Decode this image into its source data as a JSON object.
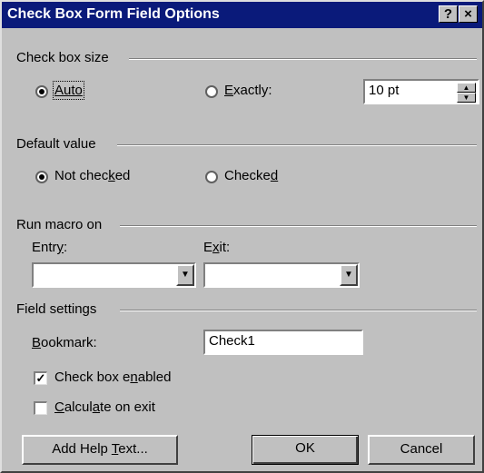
{
  "window": {
    "title": "Check Box Form Field Options",
    "help_btn": "?",
    "close_btn": "×"
  },
  "size_group": {
    "label": "Check box size",
    "auto": "Auto",
    "exactly_prefix": "",
    "exactly_u": "E",
    "exactly_rest": "xactly:",
    "value": "10 pt"
  },
  "default_group": {
    "label": "Default value",
    "not_checked_a": "Not chec",
    "not_checked_u": "k",
    "not_checked_b": "ed",
    "checked_a": "Checke",
    "checked_u": "d"
  },
  "macro_group": {
    "label": "Run macro on",
    "entry_a": "Entr",
    "entry_u": "y",
    "entry_b": ":",
    "exit_a": "E",
    "exit_u": "x",
    "exit_b": "it:",
    "entry_value": "",
    "exit_value": ""
  },
  "field_group": {
    "label": "Field settings",
    "bookmark_u": "B",
    "bookmark_rest": "ookmark:",
    "bookmark_value": "Check1",
    "enabled_a": "Check box e",
    "enabled_u": "n",
    "enabled_b": "abled",
    "calc_u": "C",
    "calc_a": "alcul",
    "calc_u2": "a",
    "calc_b": "te on exit",
    "enabled_mark": "✓"
  },
  "buttons": {
    "help_a": "Add Help ",
    "help_u": "T",
    "help_b": "ext...",
    "ok": "OK",
    "cancel": "Cancel"
  }
}
